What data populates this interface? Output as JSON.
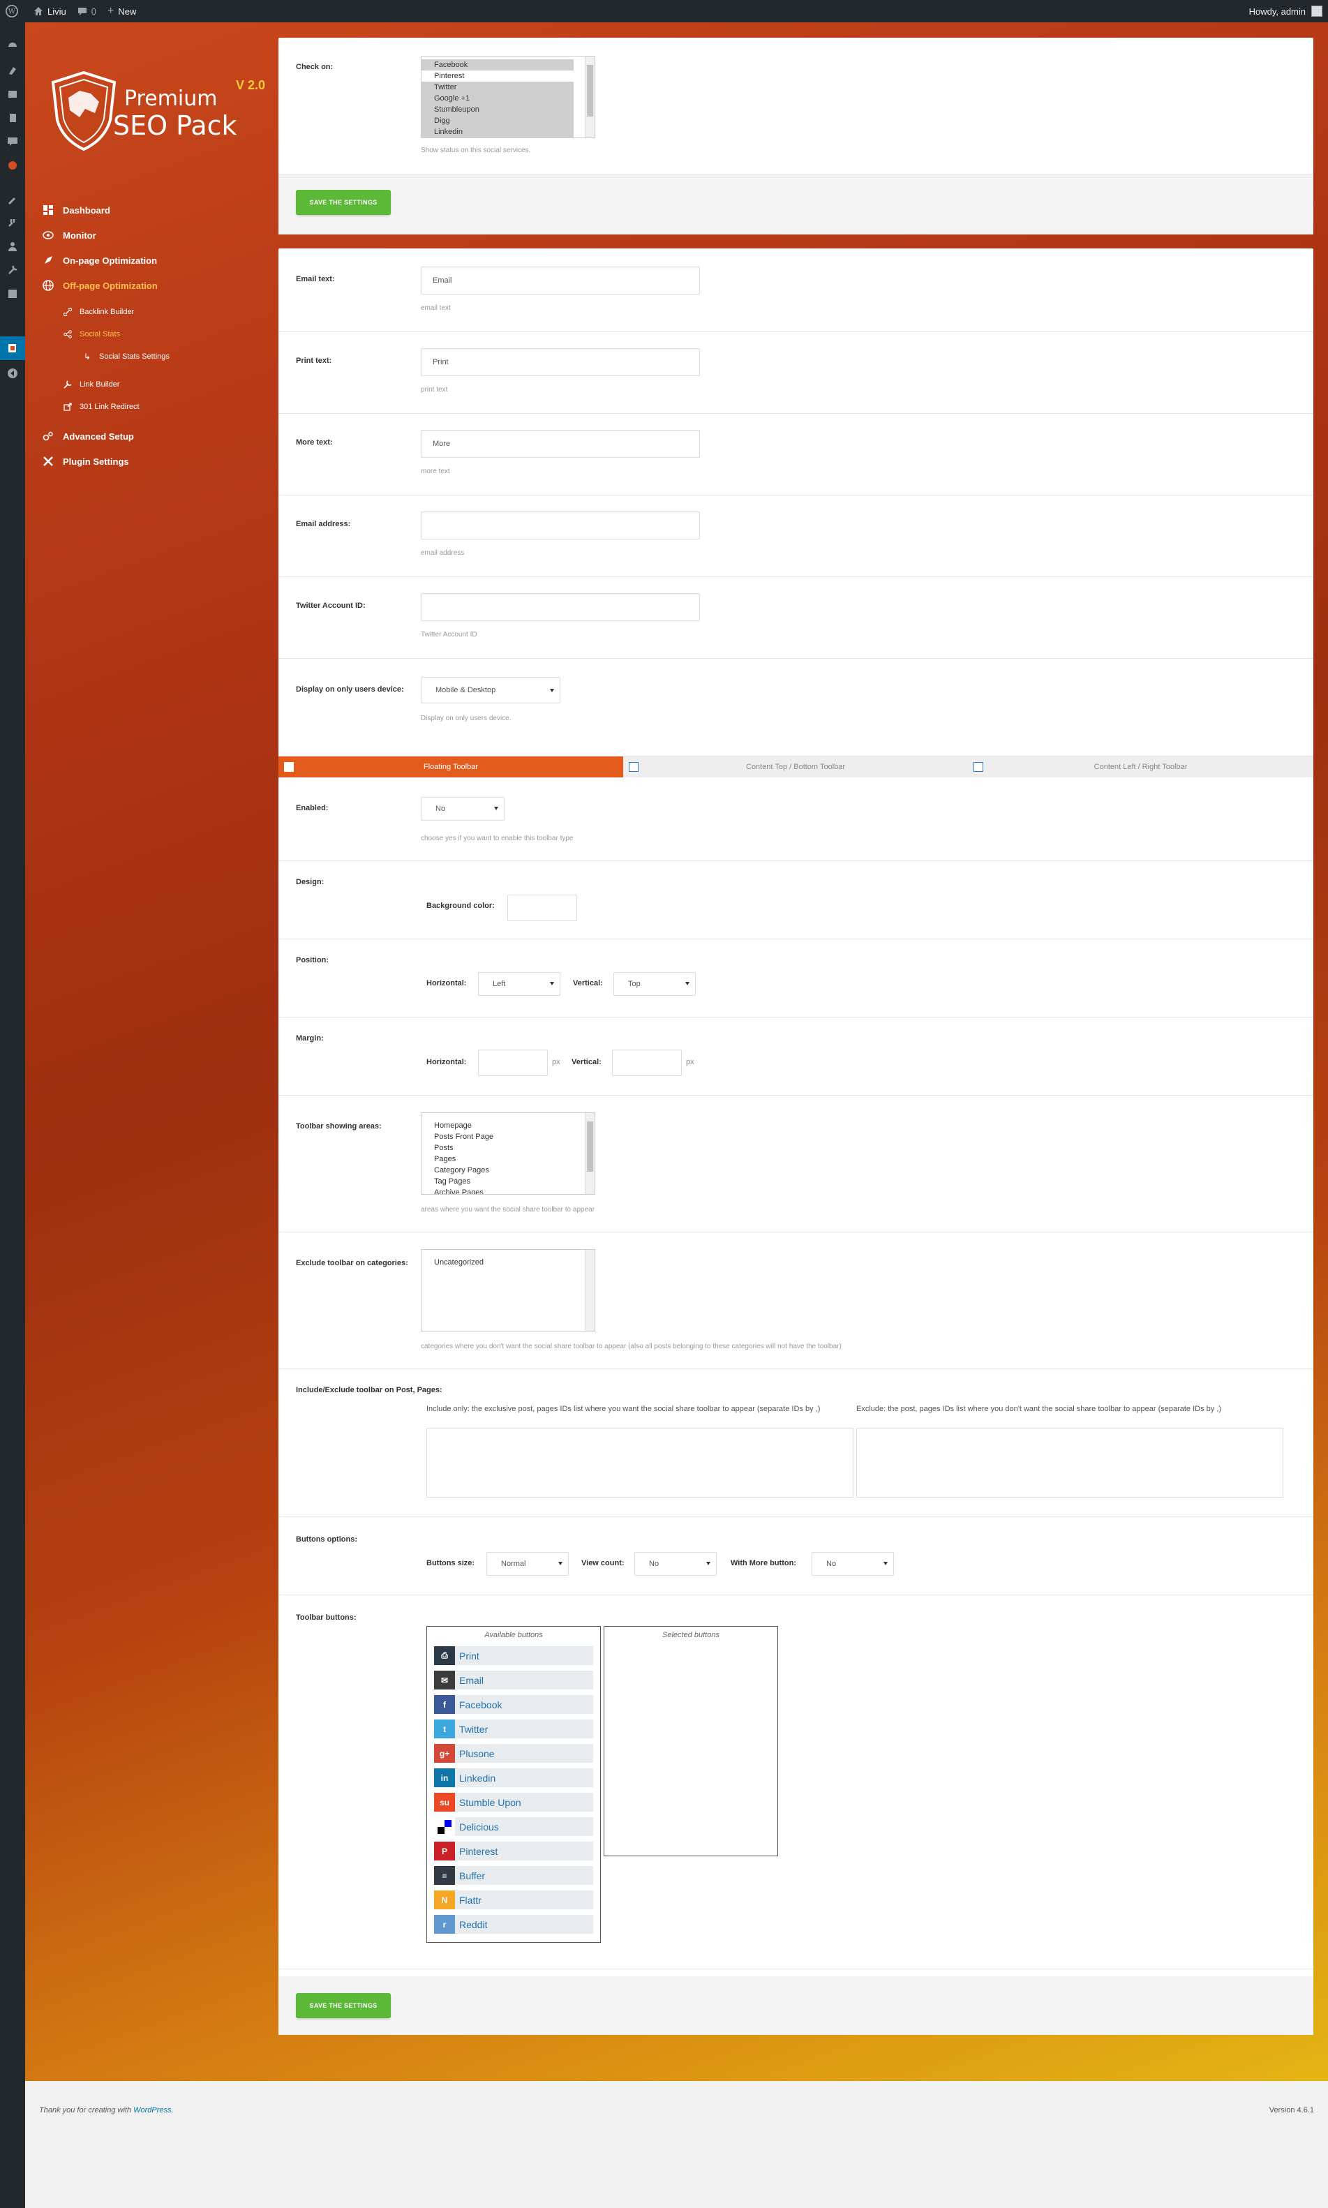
{
  "adminbar": {
    "site": "Liviu",
    "comments": "0",
    "new_label": "New",
    "howdy": "Howdy, admin"
  },
  "plugin": {
    "logo_line1": "Premium",
    "logo_line2": "SEO Pack",
    "version": "V 2.0"
  },
  "nav": {
    "dashboard": "Dashboard",
    "monitor": "Monitor",
    "onpage": "On-page Optimization",
    "offpage": "Off-page Optimization",
    "backlink": "Backlink Builder",
    "social_stats": "Social Stats",
    "social_stats_settings": "Social Stats Settings",
    "link_builder": "Link Builder",
    "redirect": "301 Link Redirect",
    "advanced": "Advanced Setup",
    "plugin_settings": "Plugin Settings"
  },
  "check_on": {
    "label": "Check on:",
    "options": [
      "Facebook",
      "Pinterest",
      "Twitter",
      "Google +1",
      "Stumbleupon",
      "Digg",
      "Linkedin"
    ],
    "selected": [
      true,
      false,
      true,
      true,
      true,
      true,
      true
    ],
    "help": "Show status on this social services."
  },
  "save_label": "SAVE THE SETTINGS",
  "email_text": {
    "label": "Email text:",
    "value": "Email",
    "help": "email text"
  },
  "print_text": {
    "label": "Print text:",
    "value": "Print",
    "help": "print text"
  },
  "more_text": {
    "label": "More text:",
    "value": "More",
    "help": "more text"
  },
  "email_address": {
    "label": "Email address:",
    "value": "",
    "help": "email address"
  },
  "twitter_id": {
    "label": "Twitter Account ID:",
    "value": "",
    "help": "Twitter Account ID"
  },
  "device": {
    "label": "Display on only users device:",
    "value": "Mobile & Desktop",
    "help": "Display on only users device."
  },
  "tabs": [
    "Floating Toolbar",
    "Content Top / Bottom Toolbar",
    "Content Left / Right Toolbar"
  ],
  "enabled": {
    "label": "Enabled:",
    "value": "No",
    "help": "choose yes if you want to enable this toolbar type"
  },
  "design": {
    "label": "Design:",
    "bg_label": "Background color:"
  },
  "position": {
    "label": "Position:",
    "horizontal_label": "Horizontal:",
    "horizontal_value": "Left",
    "vertical_label": "Vertical:",
    "vertical_value": "Top"
  },
  "margin": {
    "label": "Margin:",
    "horizontal_label": "Horizontal:",
    "vertical_label": "Vertical:",
    "unit": "px"
  },
  "areas": {
    "label": "Toolbar showing areas:",
    "options": [
      "Homepage",
      "Posts Front Page",
      "Posts",
      "Pages",
      "Category Pages",
      "Tag Pages",
      "Archive Pages"
    ],
    "help": "areas where you want the social share toolbar to appear"
  },
  "exclude_cat": {
    "label": "Exclude toolbar on categories:",
    "options": [
      "Uncategorized"
    ],
    "help": "categories where you don't want the social share toolbar to appear (also all posts belonging to these categories will not have the toolbar)"
  },
  "incl_excl": {
    "label": "Include/Exclude toolbar on Post, Pages:",
    "include_help": "Include only: the exclusive post, pages IDs list where you want the social share toolbar to appear (separate IDs by ,)",
    "exclude_help": "Exclude: the post, pages IDs list where you don't want the social share toolbar to appear (separate IDs by ,)"
  },
  "buttons_options": {
    "label": "Buttons options:",
    "size_label": "Buttons size:",
    "size_value": "Normal",
    "count_label": "View count:",
    "count_value": "No",
    "more_label": "With More button:",
    "more_value": "No"
  },
  "toolbar_buttons": {
    "label": "Toolbar buttons:",
    "available_title": "Available buttons",
    "selected_title": "Selected buttons",
    "items": [
      {
        "name": "Print",
        "color": "#2c3a47",
        "glyph": "⎙"
      },
      {
        "name": "Email",
        "color": "#3b3b3b",
        "glyph": "✉"
      },
      {
        "name": "Facebook",
        "color": "#3b5998",
        "glyph": "f"
      },
      {
        "name": "Twitter",
        "color": "#3ba9e0",
        "glyph": "t"
      },
      {
        "name": "Plusone",
        "color": "#d34836",
        "glyph": "g+"
      },
      {
        "name": "Linkedin",
        "color": "#0e76a8",
        "glyph": "in"
      },
      {
        "name": "Stumble Upon",
        "color": "#eb4823",
        "glyph": "su"
      },
      {
        "name": "Delicious",
        "color": "#ffffff",
        "glyph": ""
      },
      {
        "name": "Pinterest",
        "color": "#cb2027",
        "glyph": "P"
      },
      {
        "name": "Buffer",
        "color": "#323b43",
        "glyph": "≡"
      },
      {
        "name": "Flattr",
        "color": "#f5a623",
        "glyph": "N"
      },
      {
        "name": "Reddit",
        "color": "#5f99cf",
        "glyph": "r"
      }
    ]
  },
  "footer": {
    "thanks_prefix": "Thank you for creating with ",
    "wordpress": "WordPress",
    "thanks_suffix": ".",
    "version": "Version 4.6.1"
  }
}
